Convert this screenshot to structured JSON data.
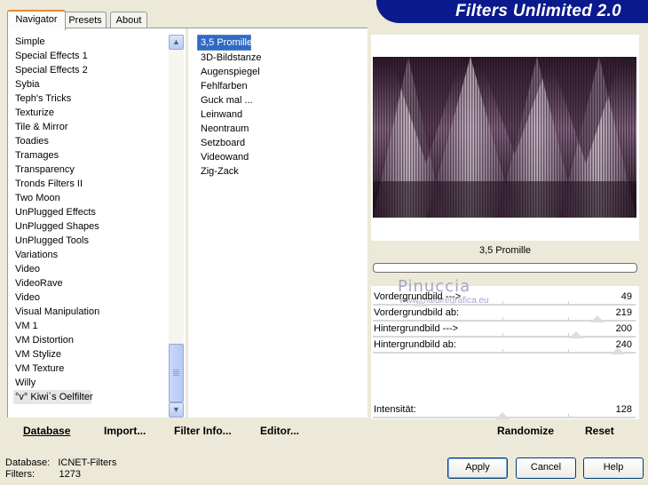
{
  "tabs": [
    {
      "label": "Navigator",
      "active": true
    },
    {
      "label": "Presets",
      "active": false
    },
    {
      "label": "About",
      "active": false
    }
  ],
  "banner": {
    "title": "Filters Unlimited 2.0",
    "color": "#0a1a8c"
  },
  "categories": [
    "Simple",
    "Special Effects 1",
    "Special Effects 2",
    "Sybia",
    "Teph's Tricks",
    "Texturize",
    "Tile & Mirror",
    "Toadies",
    "Tramages",
    "Transparency",
    "Tronds Filters II",
    "Two Moon",
    "UnPlugged Effects",
    "UnPlugged Shapes",
    "UnPlugged Tools",
    "Variations",
    "Video",
    "VideoRave",
    "Video",
    "Visual Manipulation",
    "VM 1",
    "VM Distortion",
    "VM Stylize",
    "VM Texture",
    "Willy",
    "°v° Kiwi`s Oelfilter"
  ],
  "selected_category": "°v° Kiwi`s Oelfilter",
  "filters": [
    "3,5 Promille",
    "3D-Bildstanze",
    "Augenspiegel",
    "Fehlfarben",
    "Guck mal ...",
    "Leinwand",
    "Neontraum",
    "Setzboard",
    "Videowand",
    "Zig-Zack"
  ],
  "selected_filter": "3,5 Promille",
  "toolbar": {
    "database": "Database",
    "import": "Import...",
    "filter_info": "Filter Info...",
    "editor": "Editor..."
  },
  "current_filter_name": "3,5 Promille",
  "sliders": [
    {
      "label": "Vordergrundbild --->",
      "value": "49",
      "level": 0.19
    },
    {
      "label": "Vordergrundbild ab:",
      "value": "219",
      "level": 0.86
    },
    {
      "label": "Hintergrundbild --->",
      "value": "200",
      "level": 0.78
    },
    {
      "label": "Hintergrundbild ab:",
      "value": "240",
      "level": 0.94
    }
  ],
  "intensity": {
    "label": "Intensität:",
    "value": "128",
    "level": 0.5
  },
  "watermark": {
    "name": "Pinuccia",
    "url": "www.maidiregrafica.eu"
  },
  "rtoolbar": {
    "randomize": "Randomize",
    "reset": "Reset"
  },
  "info": {
    "database_label": "Database:",
    "database_value": "ICNET-Filters",
    "filters_label": "Filters:",
    "filters_value": "1273"
  },
  "buttons": {
    "apply": "Apply",
    "cancel": "Cancel",
    "help": "Help"
  },
  "colors": {
    "selection": "#316ac5",
    "preview_dark": "#2a1a2a",
    "preview_light": "#e8dcea"
  }
}
